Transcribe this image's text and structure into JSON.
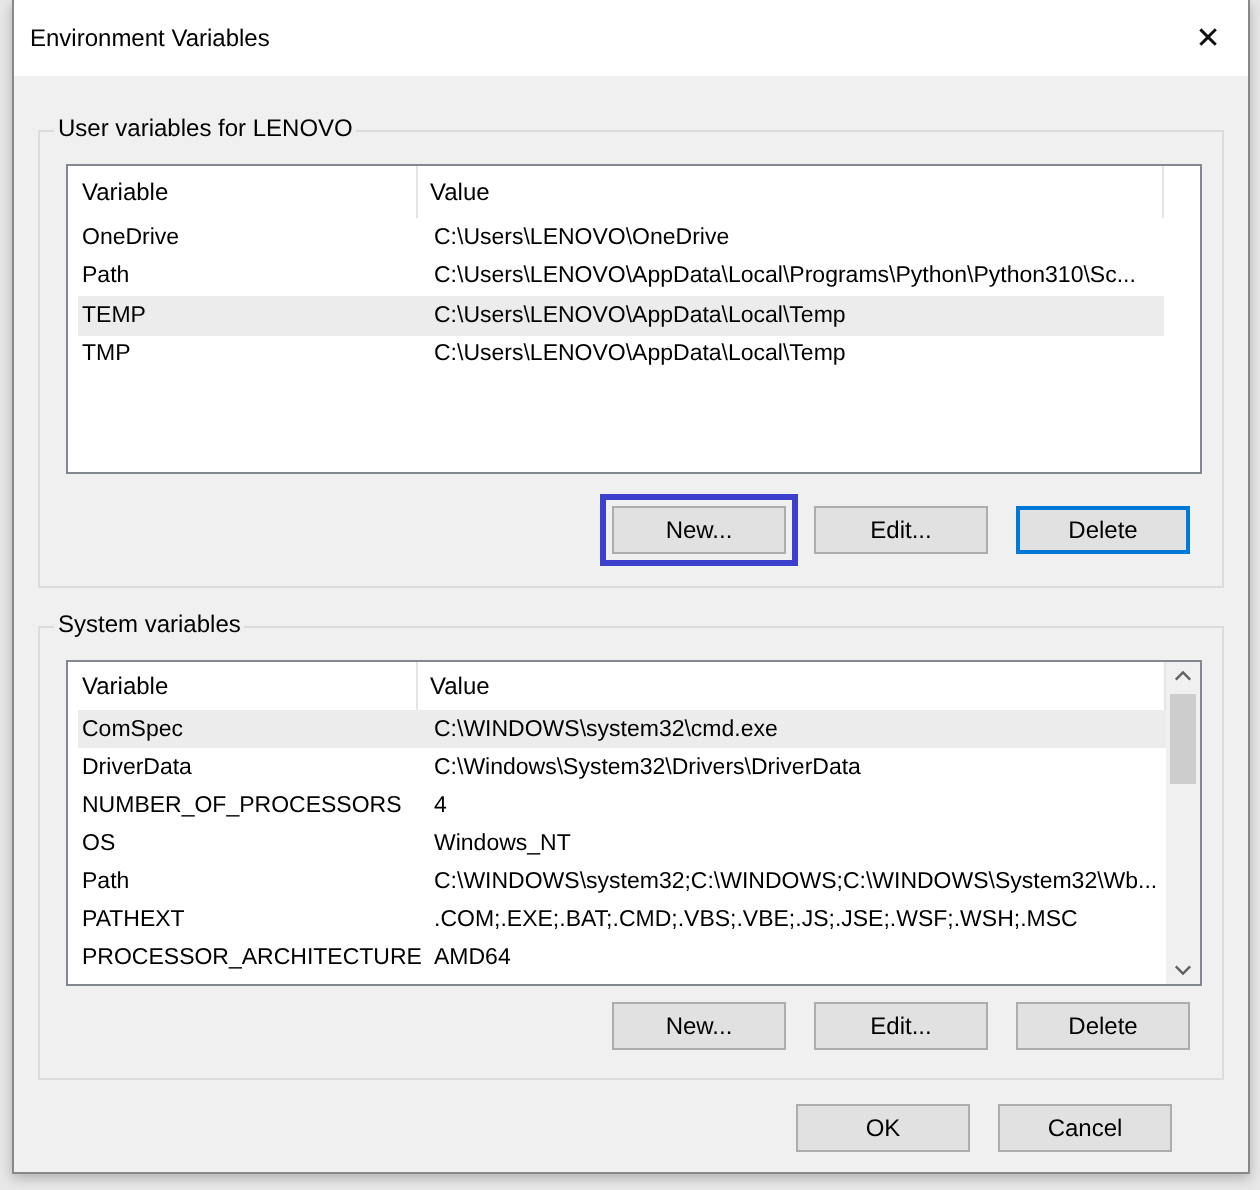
{
  "window": {
    "title": "Environment Variables",
    "close": "✕"
  },
  "user_group": {
    "title": "User variables for LENOVO",
    "columns": [
      "Variable",
      "Value"
    ],
    "rows": [
      {
        "variable": "OneDrive",
        "value": "C:\\Users\\LENOVO\\OneDrive",
        "selected": false
      },
      {
        "variable": "Path",
        "value": "C:\\Users\\LENOVO\\AppData\\Local\\Programs\\Python\\Python310\\Sc...",
        "selected": false
      },
      {
        "variable": "TEMP",
        "value": "C:\\Users\\LENOVO\\AppData\\Local\\Temp",
        "selected": true
      },
      {
        "variable": "TMP",
        "value": "C:\\Users\\LENOVO\\AppData\\Local\\Temp",
        "selected": false
      }
    ],
    "buttons": [
      {
        "label": "New...",
        "focused": false,
        "highlighted": true
      },
      {
        "label": "Edit...",
        "focused": false,
        "highlighted": false
      },
      {
        "label": "Delete",
        "focused": true,
        "highlighted": false
      }
    ]
  },
  "system_group": {
    "title": "System variables",
    "columns": [
      "Variable",
      "Value"
    ],
    "rows": [
      {
        "variable": "ComSpec",
        "value": "C:\\WINDOWS\\system32\\cmd.exe",
        "selected": true
      },
      {
        "variable": "DriverData",
        "value": "C:\\Windows\\System32\\Drivers\\DriverData",
        "selected": false
      },
      {
        "variable": "NUMBER_OF_PROCESSORS",
        "value": "4",
        "selected": false
      },
      {
        "variable": "OS",
        "value": "Windows_NT",
        "selected": false
      },
      {
        "variable": "Path",
        "value": "C:\\WINDOWS\\system32;C:\\WINDOWS;C:\\WINDOWS\\System32\\Wb...",
        "selected": false
      },
      {
        "variable": "PATHEXT",
        "value": ".COM;.EXE;.BAT;.CMD;.VBS;.VBE;.JS;.JSE;.WSF;.WSH;.MSC",
        "selected": false
      },
      {
        "variable": "PROCESSOR_ARCHITECTURE",
        "value": "AMD64",
        "selected": false
      }
    ],
    "buttons": [
      {
        "label": "New...",
        "focused": false,
        "highlighted": false
      },
      {
        "label": "Edit...",
        "focused": false,
        "highlighted": false
      },
      {
        "label": "Delete",
        "focused": false,
        "highlighted": false
      }
    ]
  },
  "footer_buttons": [
    {
      "label": "OK",
      "focused": false,
      "highlighted": false
    },
    {
      "label": "Cancel",
      "focused": false,
      "highlighted": false
    }
  ]
}
